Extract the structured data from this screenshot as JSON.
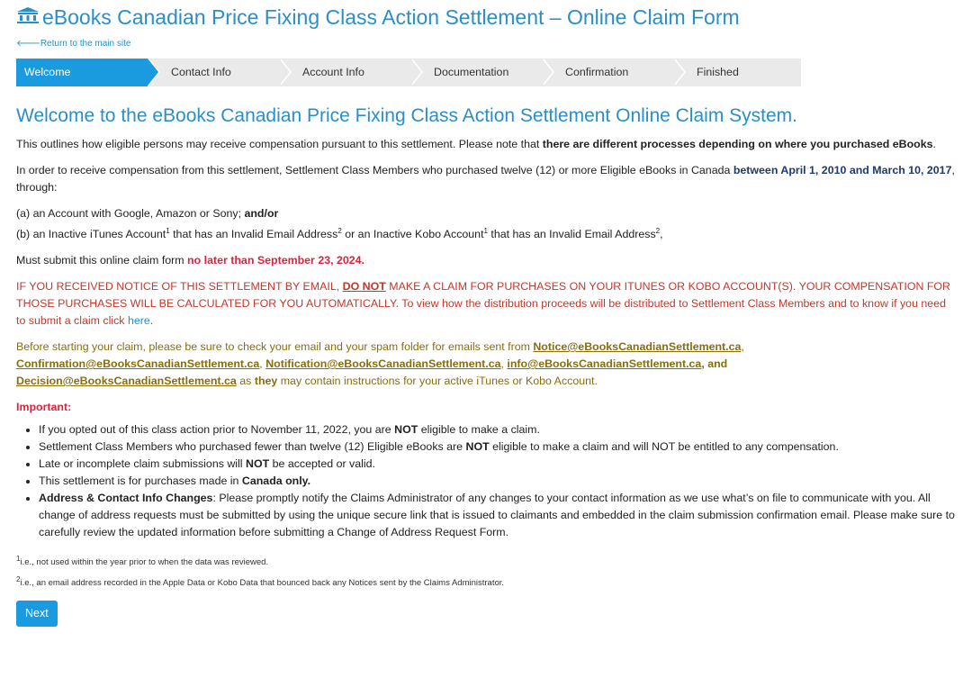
{
  "page": {
    "title": "eBooks Canadian Price Fixing Class Action Settlement – Online Claim Form",
    "back_link": "Return to the main site"
  },
  "steps": [
    "Welcome",
    "Contact Info",
    "Account Info",
    "Documentation",
    "Confirmation",
    "Finished"
  ],
  "main": {
    "heading": "Welcome to the eBooks Canadian Price Fixing Class Action Settlement Online Claim System.",
    "p1_a": "This outlines how eligible persons may receive compensation pursuant to this settlement. Please note that ",
    "p1_b": "there are different processes depending on where you purchased eBooks",
    "p1_c": ".",
    "p2_a": "In order to receive compensation from this settlement, Settlement Class Members who purchased twelve (12) or more Eligible eBooks in Canada ",
    "p2_b": "between April 1, 2010 and March 10, 2017",
    "p2_c": ", through:",
    "p3_a1": "(a) an Account with Google, Amazon or Sony; ",
    "p3_a2": "and/or",
    "p3_b1": "(b) an Inactive iTunes Account",
    "p3_b2": " that has an Invalid Email Address",
    "p3_b3": " or an Inactive Kobo Account",
    "p3_b4": " that has an Invalid Email Address",
    "p3_b5": ",",
    "sup1": "1",
    "sup2": "2",
    "p4_a": "Must submit this online claim form ",
    "p4_b": "no later than September 23, 2024.",
    "p5_a": "IF YOU RECEIVED NOTICE OF THIS SETTLEMENT BY EMAIL, ",
    "p5_b": "DO NOT",
    "p5_c": " MAKE A CLAIM FOR PURCHASES ON YOUR ITUNES OR KOBO ACCOUNT(S). YOUR COMPENSATION FOR THOSE PURCHASES WILL BE CALCULATED FOR YOU AUTOMATICALLY. To view how the distribution proceeds will be distributed to Settlement Class Members and to know if you need to submit a claim click ",
    "p5_link": "here",
    "p5_d": ".",
    "p6_a": "Before starting your claim, please be sure to check your email and your spam folder for emails sent from ",
    "email1": "Notice@eBooksCanadianSettlement.ca",
    "email2": "Confirmation@eBooksCanadianSettlement.ca",
    "email3": "Notification@eBooksCanadianSettlement.ca",
    "email4": "info@eBooksCanadianSettlement.ca",
    "email5": "Decision@eBooksCanadianSettlement.ca",
    "comma": ",",
    "and": ", and",
    "as": " as ",
    "they": "they",
    "p6_end": " may contain instructions for your active iTunes or Kobo Account.",
    "important": "Important:",
    "b1_a": "If you opted out of this class action prior to November 11, 2022, you are ",
    "b1_b": "NOT",
    "b1_c": " eligible to make a claim.",
    "b2_a": "Settlement Class Members who purchased fewer than twelve (12) Eligible eBooks are ",
    "b2_b": "NOT",
    "b2_c": " eligible to make a claim and will NOT be entitled to any compensation.",
    "b3_a": "Late or incomplete claim submissions will ",
    "b3_b": "NOT",
    "b3_c": " be accepted or valid.",
    "b4_a": "This settlement is for purchases made in ",
    "b4_b": "Canada only.",
    "b5_a": "Address & Contact Info Changes",
    "b5_b": ": Please promptly notify the Claims Administrator of any changes to your contact information as we use what’s on file to communicate with you. All change of address requests must be submitted by using the unique secure link that is issued to claimants and embedded in the claim submission confirmation email. Please make sure to carefully review the updated information before submitting a Change of Address Request Form.",
    "fn1": "i.e., not used within the year prior to when the data was reviewed.",
    "fn2": "i.e., an email address recorded in the Apple Data or Kobo Data that bounced back any Notices sent by the Claims Administrator.",
    "next_button": "Next"
  },
  "colors": {
    "accent": "#1a9be0",
    "title": "#2a8fc7",
    "red": "#d9243d",
    "orange": "#c0392b",
    "olive": "#8a6d0b",
    "navy": "#1f3a6e"
  }
}
